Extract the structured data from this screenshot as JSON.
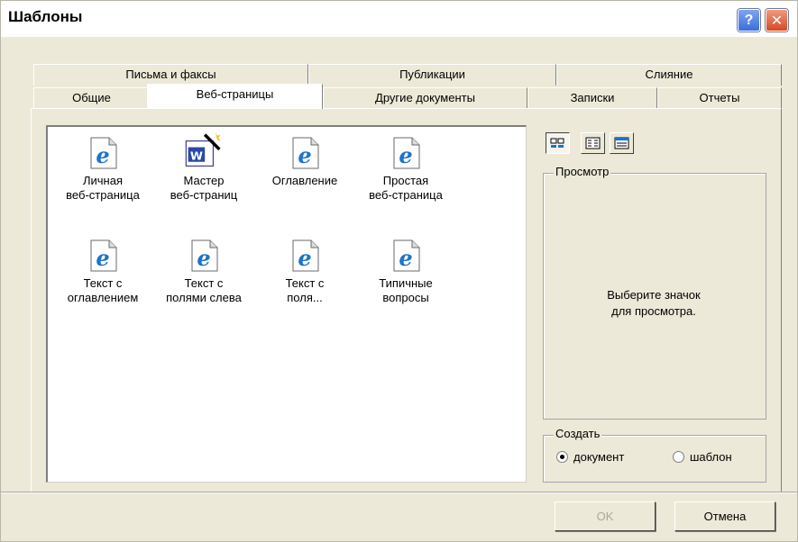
{
  "window": {
    "title": "Шаблоны"
  },
  "titlebar": {
    "help_label": "?",
    "close_label": "✕"
  },
  "tabs_back": [
    {
      "label": "Письма и факсы"
    },
    {
      "label": "Публикации"
    },
    {
      "label": "Слияние"
    }
  ],
  "tabs_front": [
    {
      "label": "Общие"
    },
    {
      "label": "Веб-страницы",
      "active": true
    },
    {
      "label": "Другие документы"
    },
    {
      "label": "Записки"
    },
    {
      "label": "Отчеты"
    }
  ],
  "templates": [
    {
      "line1": "Личная",
      "line2": "веб-страница",
      "icon": "ie-document-icon"
    },
    {
      "line1": "Мастер",
      "line2": "веб-страниц",
      "icon": "word-wizard-icon"
    },
    {
      "line1": "Оглавление",
      "line2": "",
      "icon": "ie-document-icon"
    },
    {
      "line1": "Простая",
      "line2": "веб-страница",
      "icon": "ie-document-icon"
    },
    {
      "line1": "Текст с",
      "line2": "оглавлением",
      "icon": "ie-document-icon"
    },
    {
      "line1": "Текст с",
      "line2": "полями слева",
      "icon": "ie-document-icon"
    },
    {
      "line1": "Текст с",
      "line2": "поля...",
      "icon": "ie-document-icon"
    },
    {
      "line1": "Типичные",
      "line2": "вопросы",
      "icon": "ie-document-icon"
    }
  ],
  "view_buttons": [
    {
      "icon": "large-icons-view-icon",
      "pressed": true
    },
    {
      "icon": "list-view-icon",
      "pressed": false
    },
    {
      "icon": "details-view-icon",
      "pressed": false
    }
  ],
  "preview": {
    "label": "Просмотр",
    "line1": "Выберите значок",
    "line2": "для просмотра."
  },
  "create": {
    "label": "Создать",
    "options": [
      {
        "label": "документ",
        "checked": true
      },
      {
        "label": "шаблон",
        "checked": false
      }
    ]
  },
  "buttons": {
    "ok": "OK",
    "cancel": "Отмена"
  },
  "colors": {
    "dialog_bg": "#ece9d8",
    "list_bg": "#ffffff",
    "ie_blue": "#1e73c9"
  }
}
